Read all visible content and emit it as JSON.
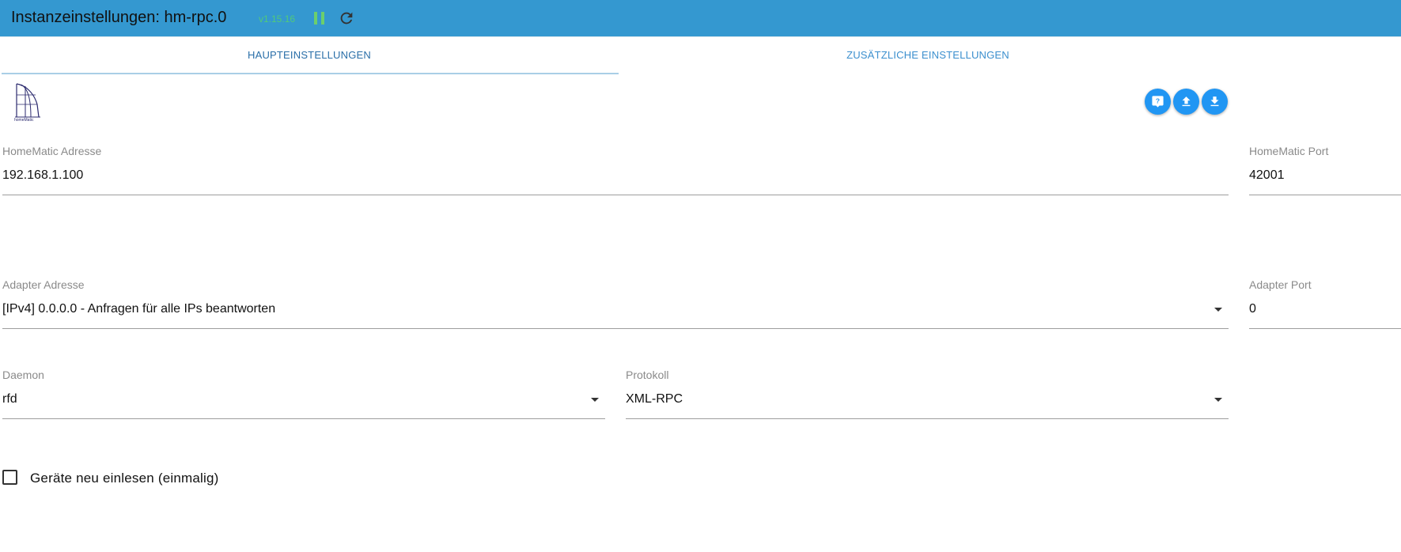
{
  "header": {
    "title": "Instanzeinstellungen: hm-rpc.0",
    "version": "v1.15.16",
    "pause_icon": "pause-icon",
    "reload_icon": "reload-icon",
    "background_color": "#3498d0"
  },
  "tabs": [
    {
      "label": "HAUPTEINSTELLUNGEN",
      "active": true
    },
    {
      "label": "ZUSÄTZLICHE EINSTELLUNGEN",
      "active": false
    }
  ],
  "logo": {
    "icon": "homematic-logo",
    "text": "homeMatic"
  },
  "toolbar": {
    "help_icon": "help-icon",
    "upload_icon": "upload-icon",
    "download_icon": "download-icon",
    "accent_color": "#2196f3"
  },
  "form": {
    "homematic_address": {
      "label": "HomeMatic Adresse",
      "value": "192.168.1.100"
    },
    "homematic_port": {
      "label": "HomeMatic Port",
      "value": "42001"
    },
    "adapter_address": {
      "label": "Adapter Adresse",
      "value": "[IPv4] 0.0.0.0 - Anfragen für alle IPs beantworten"
    },
    "adapter_port": {
      "label": "Adapter Port",
      "value": "0"
    },
    "daemon": {
      "label": "Daemon",
      "value": "rfd"
    },
    "protocol": {
      "label": "Protokoll",
      "value": "XML-RPC"
    },
    "reread_devices": {
      "label": "Geräte neu einlesen (einmalig)",
      "checked": false
    }
  }
}
